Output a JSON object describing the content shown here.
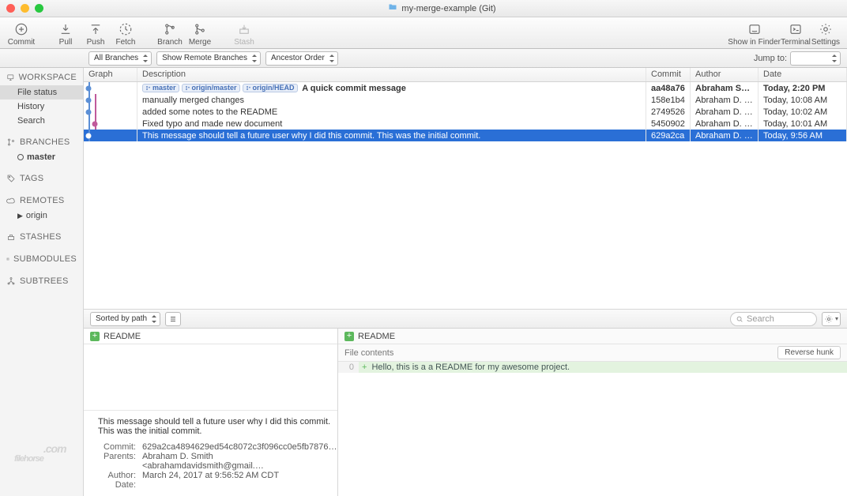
{
  "window": {
    "title": "my-merge-example (Git)"
  },
  "toolbar": {
    "commit": "Commit",
    "pull": "Pull",
    "push": "Push",
    "fetch": "Fetch",
    "branch": "Branch",
    "merge": "Merge",
    "stash": "Stash",
    "showFinder": "Show in Finder",
    "terminal": "Terminal",
    "settings": "Settings"
  },
  "filters": {
    "branches": "All Branches",
    "remote": "Show Remote Branches",
    "order": "Ancestor Order",
    "jumpLabel": "Jump to:"
  },
  "sidebar": {
    "workspace": "WORKSPACE",
    "fileStatus": "File status",
    "history": "History",
    "search": "Search",
    "branches": "BRANCHES",
    "master": "master",
    "tags": "TAGS",
    "remotes": "REMOTES",
    "origin": "origin",
    "stashes": "STASHES",
    "submodules": "SUBMODULES",
    "subtrees": "SUBTREES"
  },
  "columns": {
    "graph": "Graph",
    "desc": "Description",
    "commit": "Commit",
    "author": "Author",
    "date": "Date"
  },
  "tags": {
    "master": "master",
    "originMaster": "origin/master",
    "originHead": "origin/HEAD"
  },
  "commits": [
    {
      "desc": "A quick commit message",
      "hash": "aa48a76",
      "author": "Abraham Smith <…",
      "date": "Today, 2:20 PM",
      "bold": true,
      "tags": true
    },
    {
      "desc": "manually merged changes",
      "hash": "158e1b4",
      "author": "Abraham D. Smith…",
      "date": "Today, 10:08 AM"
    },
    {
      "desc": "added some notes to the README",
      "hash": "2749526",
      "author": "Abraham D. Smith…",
      "date": "Today, 10:02 AM"
    },
    {
      "desc": "Fixed typo and made new document",
      "hash": "5450902",
      "author": "Abraham D. Smith…",
      "date": "Today, 10:01 AM"
    },
    {
      "desc": "This message should tell a future user why I did this commit. This was the initial commit.",
      "hash": "629a2ca",
      "author": "Abraham D. Smith…",
      "date": "Today, 9:56 AM",
      "sel": true
    }
  ],
  "midbar": {
    "sort": "Sorted by path",
    "searchPlaceholder": "Search"
  },
  "file": {
    "name": "README"
  },
  "diff": {
    "file": "README",
    "contentsLabel": "File contents",
    "reverse": "Reverse hunk",
    "lineNo": "0",
    "line": "Hello, this is a a README for my awesome project."
  },
  "meta": {
    "msg": "This message should tell a future user why I did this commit. This was the initial commit.",
    "commitLabel": "Commit:",
    "commitVal": "629a2ca4894629ed54c8072c3f096cc0e5fb7876…",
    "parentsLabel": "Parents:",
    "parentsVal": "Abraham D. Smith <abrahamdavidsmith@gmail.…",
    "authorLabel": "Author:",
    "dateLabel": "Date:",
    "dateVal": "March 24, 2017 at 9:56:52 AM CDT"
  },
  "watermark": {
    "a": "filehorse",
    "b": ".com"
  }
}
